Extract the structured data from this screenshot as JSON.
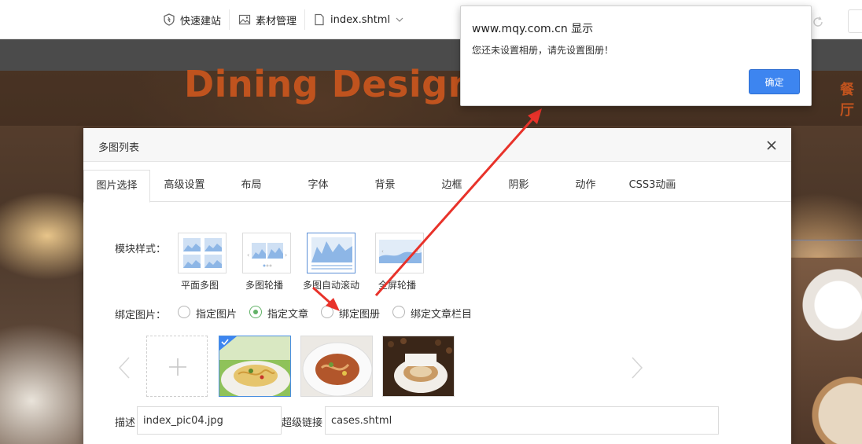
{
  "toolbar": {
    "quick_build": "快速建站",
    "material_manage": "素材管理",
    "file_name": "index.shtml"
  },
  "site": {
    "hero_title": "Dining Design",
    "hero_side_text": "餐厅"
  },
  "modal": {
    "title": "多图列表",
    "tabs": [
      {
        "label": "图片选择",
        "active": true
      },
      {
        "label": "高级设置"
      },
      {
        "label": "布局"
      },
      {
        "label": "字体"
      },
      {
        "label": "背景"
      },
      {
        "label": "边框"
      },
      {
        "label": "阴影"
      },
      {
        "label": "动作"
      },
      {
        "label": "CSS3动画"
      }
    ],
    "module_style_label": "模块样式：",
    "styles": [
      {
        "caption": "平面多图"
      },
      {
        "caption": "多图轮播"
      },
      {
        "caption": "多图自动滚动",
        "selected": true
      },
      {
        "caption": "全屏轮播"
      }
    ],
    "bind_label": "绑定图片：",
    "bind_options": [
      {
        "label": "指定图片"
      },
      {
        "label": "指定文章",
        "checked": true
      },
      {
        "label": "绑定图册"
      },
      {
        "label": "绑定文章栏目"
      }
    ],
    "desc_label": "描述",
    "desc_value": "index_pic04.jpg",
    "link_label": "超级链接",
    "link_value": "cases.shtml"
  },
  "alert": {
    "origin": "www.mqy.com.cn 显示",
    "message": "您还未设置相册，请先设置图册！",
    "ok_label": "确定"
  },
  "colors": {
    "accent_blue": "#3d85f0",
    "radio_green": "#62b267",
    "hero_orange": "#c0531e",
    "annotation_red": "#e8322a"
  }
}
